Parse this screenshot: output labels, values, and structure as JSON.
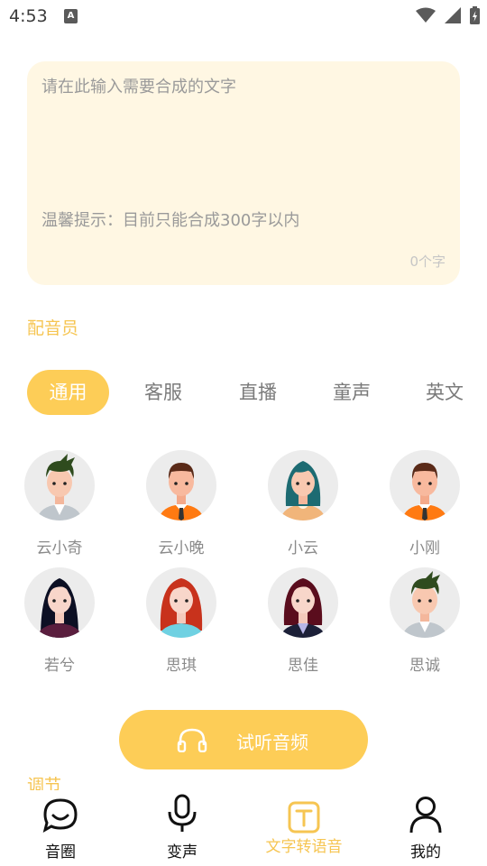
{
  "status_bar": {
    "time": "4:53",
    "notification_badge": "A"
  },
  "text_area": {
    "placeholder": "请在此输入需要合成的文字",
    "value": "",
    "hint": "温馨提示：目前只能合成300字以内",
    "char_count": "0个字"
  },
  "voice_section": {
    "title": "配音员"
  },
  "tabs": [
    {
      "label": "通用",
      "active": true
    },
    {
      "label": "客服",
      "active": false
    },
    {
      "label": "直播",
      "active": false
    },
    {
      "label": "童声",
      "active": false
    },
    {
      "label": "英文",
      "active": false
    }
  ],
  "speakers": [
    {
      "name": "云小奇",
      "avatar": "man-green-hair-icon"
    },
    {
      "name": "云小晚",
      "avatar": "man-orange-shirt-icon"
    },
    {
      "name": "小云",
      "avatar": "woman-teal-hair-icon"
    },
    {
      "name": "小刚",
      "avatar": "man-orange-shirt-icon"
    },
    {
      "name": "若兮",
      "avatar": "woman-black-hair-icon"
    },
    {
      "name": "思琪",
      "avatar": "woman-red-hair-icon"
    },
    {
      "name": "思佳",
      "avatar": "woman-maroon-hair-icon"
    },
    {
      "name": "思诚",
      "avatar": "man-green-hair-icon"
    }
  ],
  "preview_button": {
    "label": "试听音频",
    "icon": "headphones-icon"
  },
  "adjust_section": {
    "title": "调节"
  },
  "bottom_nav": [
    {
      "label": "音圈",
      "icon": "chat-bubble-icon",
      "active": false
    },
    {
      "label": "变声",
      "icon": "microphone-icon",
      "active": false
    },
    {
      "label": "文字转语音",
      "icon": "text-box-icon",
      "active": true
    },
    {
      "label": "我的",
      "icon": "person-icon",
      "active": false
    }
  ],
  "colors": {
    "accent": "#fdcd57",
    "accent_text": "#f6c552",
    "input_bg": "#fff7e3",
    "muted_text": "#8a8a8a"
  }
}
